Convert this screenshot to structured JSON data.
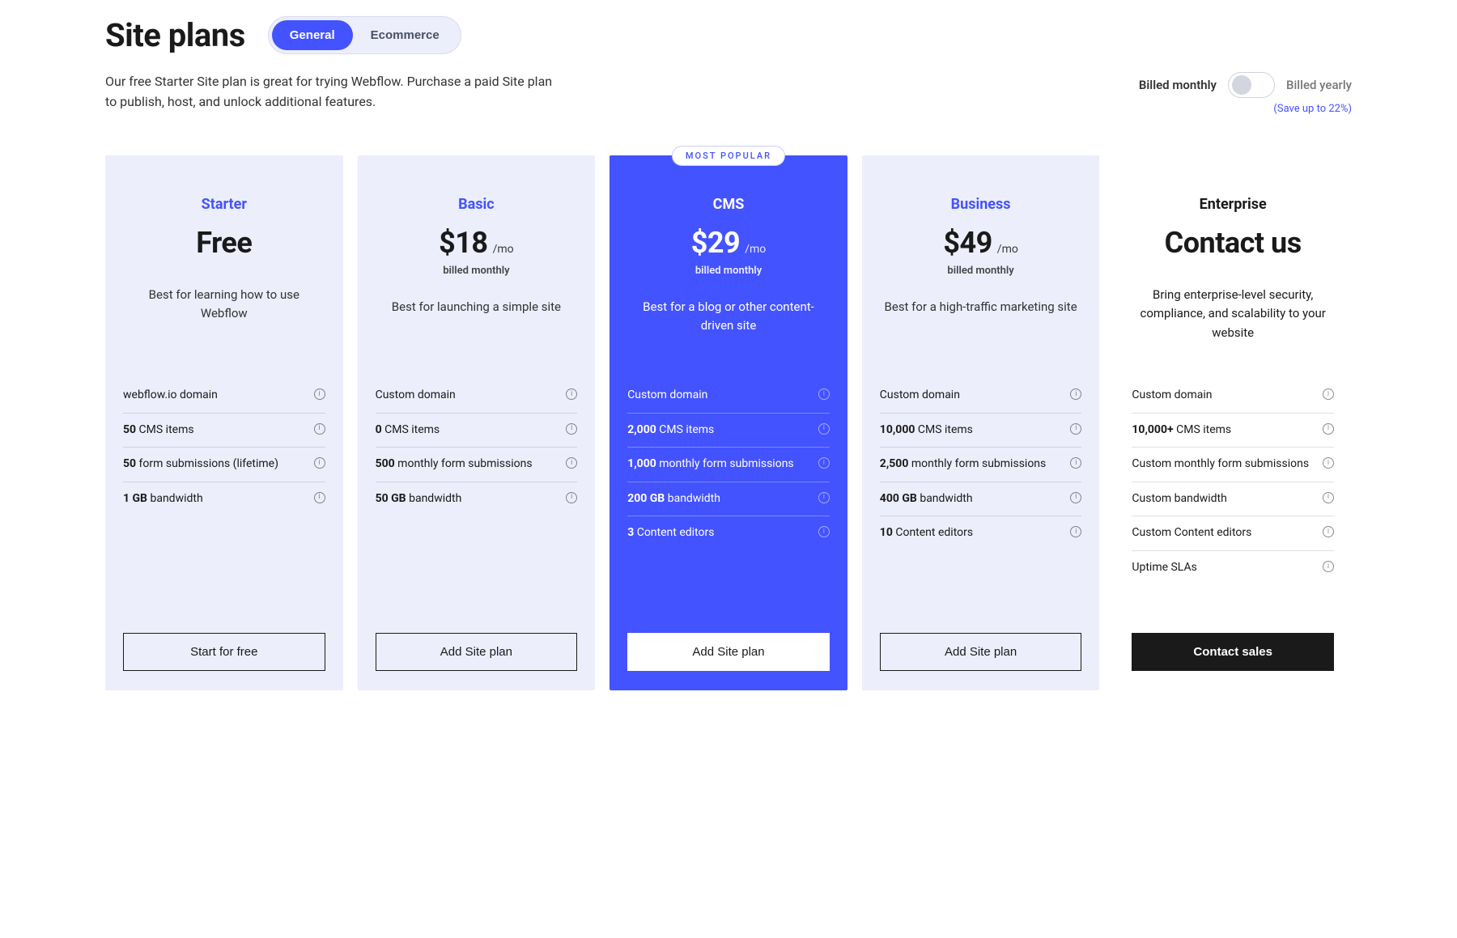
{
  "header": {
    "title": "Site plans",
    "tabs": {
      "general": "General",
      "ecommerce": "Ecommerce"
    },
    "subtitle": "Our free Starter Site plan is great for trying Webflow. Purchase a paid Site plan to publish, host, and unlock additional features."
  },
  "billing": {
    "monthly": "Billed monthly",
    "yearly": "Billed yearly",
    "save_note": "(Save up to 22%)"
  },
  "badge": "MOST POPULAR",
  "plans": [
    {
      "name": "Starter",
      "price": "Free",
      "per": "",
      "billed": "",
      "desc": "Best for learning how to use Webflow",
      "cta": "Start for free",
      "features": [
        {
          "bold": "",
          "text": "webflow.io domain"
        },
        {
          "bold": "50",
          "text": " CMS items"
        },
        {
          "bold": "50",
          "text": " form submissions (lifetime)"
        },
        {
          "bold": "1 GB",
          "text": " bandwidth"
        }
      ]
    },
    {
      "name": "Basic",
      "price": "$18",
      "per": "/mo",
      "billed": "billed monthly",
      "desc": "Best for launching a simple site",
      "cta": "Add Site plan",
      "features": [
        {
          "bold": "",
          "text": "Custom domain"
        },
        {
          "bold": "0",
          "text": " CMS items"
        },
        {
          "bold": "500",
          "text": " monthly form submissions"
        },
        {
          "bold": "50 GB",
          "text": " bandwidth"
        }
      ]
    },
    {
      "name": "CMS",
      "price": "$29",
      "per": "/mo",
      "billed": "billed monthly",
      "desc": "Best for a blog or other content-driven site",
      "cta": "Add Site plan",
      "features": [
        {
          "bold": "",
          "text": "Custom domain"
        },
        {
          "bold": "2,000",
          "text": " CMS items"
        },
        {
          "bold": "1,000",
          "text": " monthly form submissions"
        },
        {
          "bold": "200 GB",
          "text": " bandwidth"
        },
        {
          "bold": "3",
          "text": " Content editors"
        }
      ]
    },
    {
      "name": "Business",
      "price": "$49",
      "per": "/mo",
      "billed": "billed monthly",
      "desc": "Best for a high-traffic marketing site",
      "cta": "Add Site plan",
      "features": [
        {
          "bold": "",
          "text": "Custom domain"
        },
        {
          "bold": "10,000",
          "text": " CMS items"
        },
        {
          "bold": "2,500",
          "text": " monthly form submissions"
        },
        {
          "bold": "400 GB",
          "text": " bandwidth"
        },
        {
          "bold": "10",
          "text": " Content editors"
        }
      ]
    },
    {
      "name": "Enterprise",
      "price": "Contact us",
      "per": "",
      "billed": "",
      "desc": "Bring enterprise-level security, compliance, and scalability to your website",
      "cta": "Contact sales",
      "features": [
        {
          "bold": "",
          "text": "Custom domain"
        },
        {
          "bold": "10,000+",
          "text": " CMS items"
        },
        {
          "bold": "",
          "text": "Custom monthly form submissions"
        },
        {
          "bold": "",
          "text": "Custom bandwidth"
        },
        {
          "bold": "",
          "text": "Custom Content editors"
        },
        {
          "bold": "",
          "text": "Uptime SLAs"
        }
      ]
    }
  ]
}
